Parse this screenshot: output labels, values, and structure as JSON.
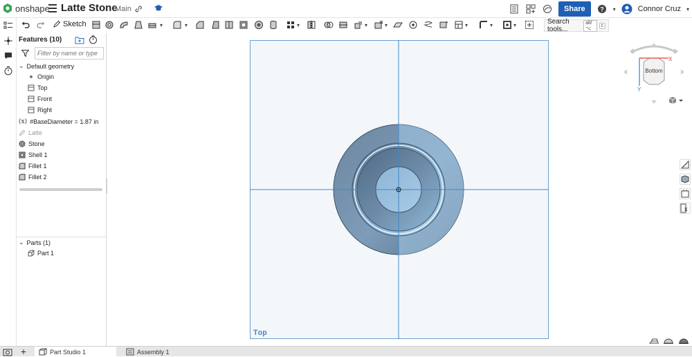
{
  "app": {
    "brand": "onshape",
    "document_title": "Latte Stone",
    "branch": "Main"
  },
  "header": {
    "share_label": "Share",
    "user_name": "Connor Cruz"
  },
  "toolbar": {
    "sketch_label": "Sketch",
    "search_label": "Search tools...",
    "search_shortcut_1": "alt/⌥",
    "search_shortcut_2": "c"
  },
  "feature_panel": {
    "header": "Features (10)",
    "filter_placeholder": "Filter by name or type",
    "items": [
      {
        "label": "Default geometry",
        "icon": "chevron-down-icon",
        "kind": "group"
      },
      {
        "label": "Origin",
        "icon": "origin-point-icon",
        "kind": "child"
      },
      {
        "label": "Top",
        "icon": "plane-icon",
        "kind": "child"
      },
      {
        "label": "Front",
        "icon": "plane-icon",
        "kind": "child"
      },
      {
        "label": "Right",
        "icon": "plane-icon",
        "kind": "child"
      },
      {
        "label": "#BaseDiameter = 1.87 in",
        "icon": "variable-icon",
        "kind": "feature"
      },
      {
        "label": "Latte",
        "icon": "sketch-icon",
        "kind": "feature-dim"
      },
      {
        "label": "Stone",
        "icon": "revolve-icon",
        "kind": "feature"
      },
      {
        "label": "Shell 1",
        "icon": "shell-icon",
        "kind": "feature"
      },
      {
        "label": "Fillet 1",
        "icon": "fillet-icon",
        "kind": "feature"
      },
      {
        "label": "Fillet 2",
        "icon": "fillet-icon",
        "kind": "feature"
      }
    ],
    "parts_header": "Parts (1)",
    "parts": [
      {
        "label": "Part 1",
        "icon": "part-icon"
      }
    ]
  },
  "viewport": {
    "plane_label": "Top",
    "view_cube_face": "Bottom",
    "axis_x": "X",
    "axis_y": "Y"
  },
  "tabs": [
    {
      "label": "Part Studio 1",
      "icon": "part-studio-icon",
      "active": true
    },
    {
      "label": "Assembly 1",
      "icon": "assembly-icon",
      "active": false
    }
  ],
  "colors": {
    "accent": "#1f5fb5",
    "plane_edge": "#6aa0cf",
    "part_dark": "#5e7891",
    "part_light": "#9cc6e4"
  }
}
